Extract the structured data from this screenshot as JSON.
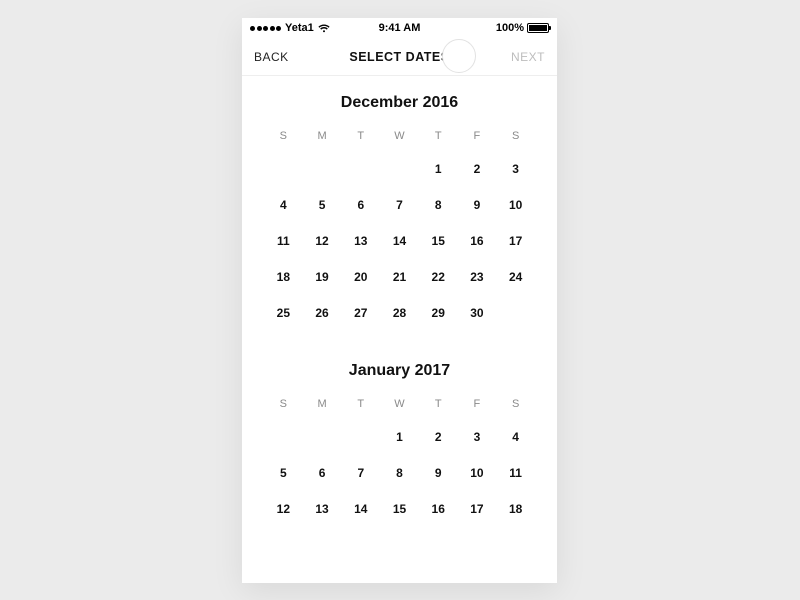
{
  "statusbar": {
    "carrier": "Yeta1",
    "time": "9:41 AM",
    "battery": "100%"
  },
  "nav": {
    "back": "BACK",
    "title": "SELECT DATES",
    "next": "NEXT"
  },
  "dow": [
    "S",
    "M",
    "T",
    "W",
    "T",
    "F",
    "S"
  ],
  "months": [
    {
      "title": "December 2016",
      "offset": 4,
      "days": [
        1,
        2,
        3,
        4,
        5,
        6,
        7,
        8,
        9,
        10,
        11,
        12,
        13,
        14,
        15,
        16,
        17,
        18,
        19,
        20,
        21,
        22,
        23,
        24,
        25,
        26,
        27,
        28,
        29,
        30
      ]
    },
    {
      "title": "January 2017",
      "offset": 3,
      "days": [
        1,
        2,
        3,
        4,
        5,
        6,
        7,
        8,
        9,
        10,
        11,
        12,
        13,
        14,
        15,
        16,
        17,
        18
      ]
    }
  ]
}
